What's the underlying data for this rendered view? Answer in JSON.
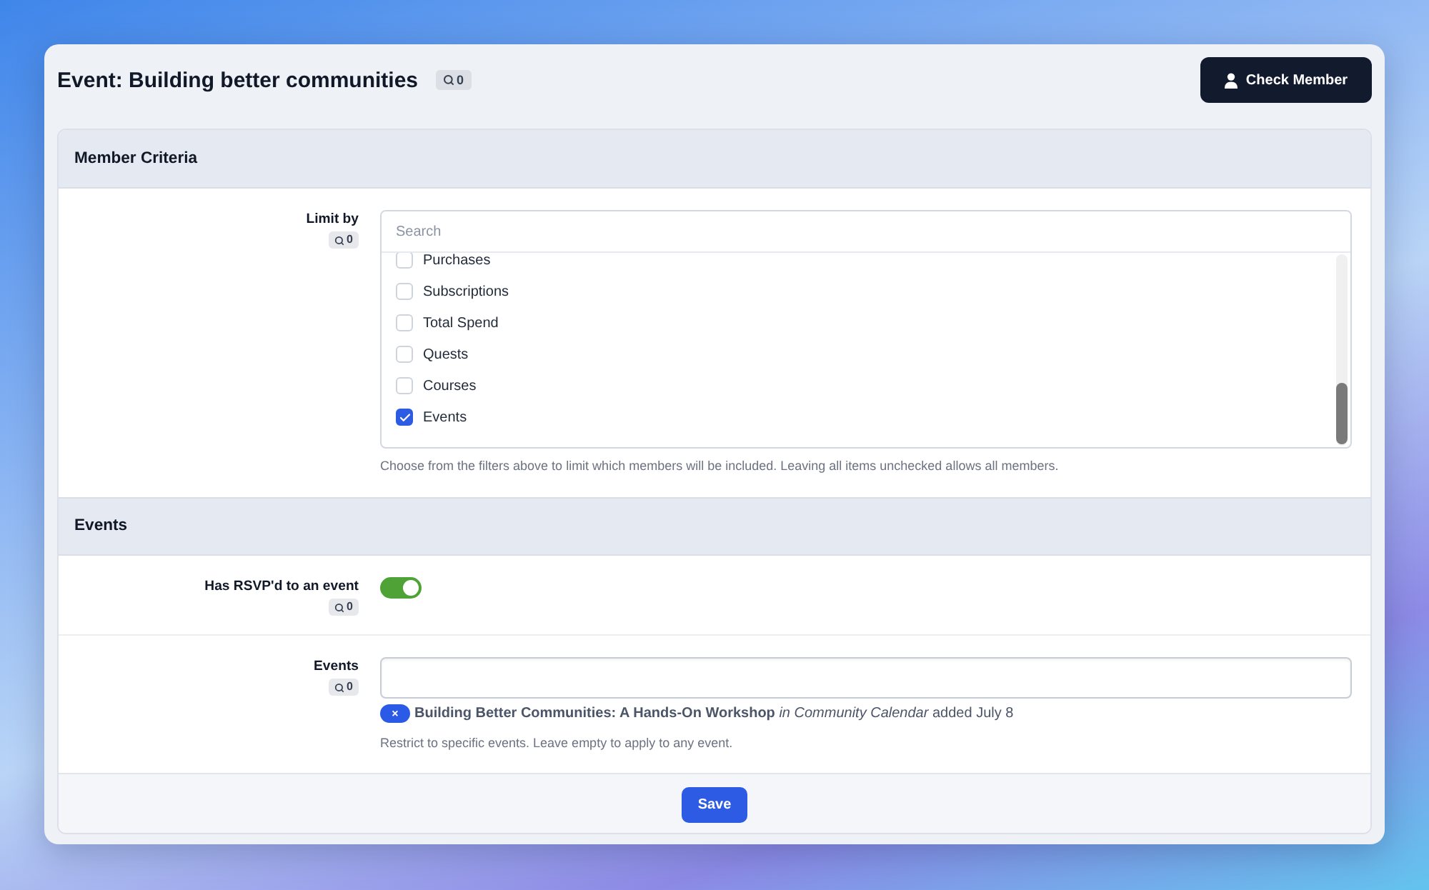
{
  "header": {
    "title": "Event: Building better communities",
    "search_count": "0",
    "check_member_button": "Check Member"
  },
  "sections": [
    {
      "title": "Member Criteria",
      "fields": [
        {
          "kind": "checklist",
          "label": "Limit by",
          "search_count": "0",
          "search": {
            "placeholder": "Search"
          },
          "options": [
            {
              "label": "Purchases",
              "checked": false
            },
            {
              "label": "Subscriptions",
              "checked": false
            },
            {
              "label": "Total Spend",
              "checked": false
            },
            {
              "label": "Quests",
              "checked": false
            },
            {
              "label": "Courses",
              "checked": false
            },
            {
              "label": "Events",
              "checked": true
            }
          ],
          "help": "Choose from the filters above to limit which members will be included. Leaving all items unchecked allows all members."
        }
      ]
    },
    {
      "title": "Events",
      "fields": [
        {
          "kind": "toggle",
          "label": "Has RSVP'd to an event",
          "search_count": "0",
          "on": true
        },
        {
          "kind": "multiselect",
          "label": "Events",
          "search_count": "0",
          "selected_items": [
            {
              "remove": "×",
              "text": "**Building Better Communities: A Hands-On Workshop** *in Community Calendar* added July 8"
            }
          ],
          "help": "Restrict to specific events. Leave empty to apply to any event."
        }
      ]
    }
  ],
  "save_button": "Save"
}
